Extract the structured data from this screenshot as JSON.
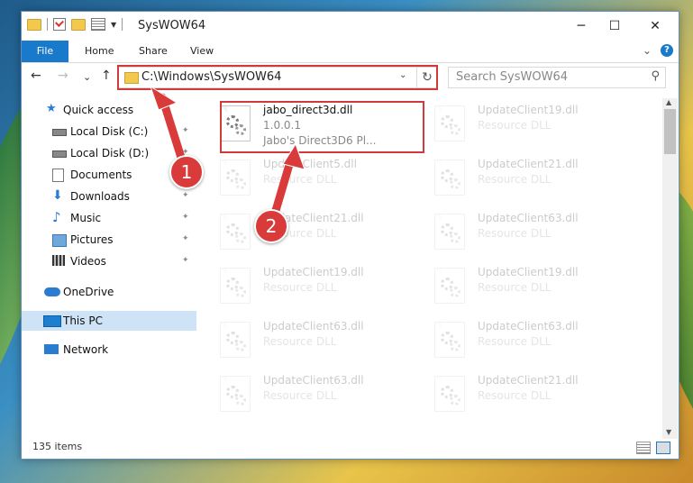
{
  "window": {
    "title": "SysWOW64",
    "minimize_glyph": "─",
    "maximize_glyph": "☐",
    "close_glyph": "✕"
  },
  "ribbon": {
    "tabs": [
      "File",
      "Home",
      "Share",
      "View"
    ],
    "expand_glyph": "⌄",
    "help_glyph": "?"
  },
  "navigation": {
    "back_glyph": "←",
    "forward_glyph": "→",
    "recent_glyph": "⌄",
    "up_glyph": "↑",
    "address": "C:\\Windows\\SysWOW64",
    "address_dropdown_glyph": "⌄",
    "refresh_glyph": "↻",
    "search_placeholder": "Search SysWOW64",
    "search_glyph": "⚲"
  },
  "sidebar": {
    "items": [
      {
        "label": "Quick access",
        "icon": "star-icon",
        "pinned": false
      },
      {
        "label": "Local Disk (C:)",
        "icon": "drive-icon",
        "pinned": true
      },
      {
        "label": "Local Disk (D:)",
        "icon": "drive-icon",
        "pinned": true
      },
      {
        "label": "Documents",
        "icon": "documents-icon",
        "pinned": true
      },
      {
        "label": "Downloads",
        "icon": "downloads-icon",
        "pinned": true
      },
      {
        "label": "Music",
        "icon": "music-icon",
        "pinned": true
      },
      {
        "label": "Pictures",
        "icon": "pictures-icon",
        "pinned": true
      },
      {
        "label": "Videos",
        "icon": "videos-icon",
        "pinned": true
      },
      {
        "label": "OneDrive",
        "icon": "onedrive-icon",
        "pinned": false
      },
      {
        "label": "This PC",
        "icon": "this-pc-icon",
        "pinned": false,
        "selected": true
      },
      {
        "label": "Network",
        "icon": "network-icon",
        "pinned": false
      }
    ],
    "pin_glyph": "📌"
  },
  "files": [
    {
      "name": "jabo_direct3d.dll",
      "line1": "1.0.0.1",
      "line2": "Jabo's Direct3D6 Pl...",
      "highlighted": true
    },
    {
      "name": "UpdateClient19.dll",
      "line1": "Resource DLL"
    },
    {
      "name": "UpdateClient5.dll",
      "line1": "Resource DLL"
    },
    {
      "name": "UpdateClient21.dll",
      "line1": "Resource DLL"
    },
    {
      "name": "UpdateClient21.dll",
      "line1": "Resource DLL"
    },
    {
      "name": "UpdateClient63.dll",
      "line1": "Resource DLL"
    },
    {
      "name": "UpdateClient19.dll",
      "line1": "Resource DLL"
    },
    {
      "name": "UpdateClient19.dll",
      "line1": "Resource DLL"
    },
    {
      "name": "UpdateClient63.dll",
      "line1": "Resource DLL"
    },
    {
      "name": "UpdateClient63.dll",
      "line1": "Resource DLL"
    },
    {
      "name": "UpdateClient63.dll",
      "line1": "Resource DLL"
    },
    {
      "name": "UpdateClient21.dll",
      "line1": "Resource DLL"
    }
  ],
  "status": {
    "item_count": "135 items"
  },
  "annotations": {
    "step1": "1",
    "step2": "2",
    "color": "#d93b3b"
  }
}
